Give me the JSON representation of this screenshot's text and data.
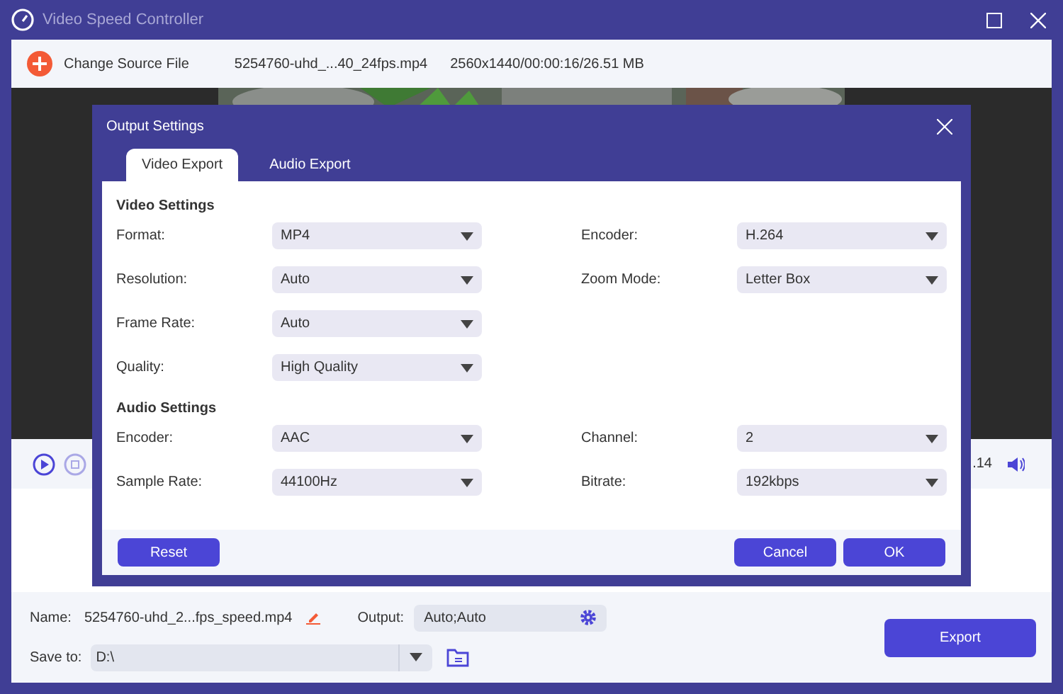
{
  "window": {
    "title": "Video Speed Controller"
  },
  "toolbar": {
    "add_label": "Change Source File",
    "file_name": "5254760-uhd_...40_24fps.mp4",
    "file_info": "2560x1440/00:00:16/26.51 MB"
  },
  "player": {
    "time": ".14"
  },
  "dialog": {
    "title": "Output Settings",
    "tabs": [
      {
        "label": "Video Export",
        "selected": true
      },
      {
        "label": "Audio Export",
        "selected": false
      }
    ],
    "sections": [
      {
        "heading": "Video Settings",
        "rows": [
          [
            {
              "label": "Format:",
              "value": "MP4"
            },
            {
              "label": "Encoder:",
              "value": "H.264"
            }
          ],
          [
            {
              "label": "Resolution:",
              "value": "Auto"
            },
            {
              "label": "Zoom Mode:",
              "value": "Letter Box"
            }
          ],
          [
            {
              "label": "Frame Rate:",
              "value": "Auto"
            }
          ],
          [
            {
              "label": "Quality:",
              "value": "High Quality"
            }
          ]
        ]
      },
      {
        "heading": "Audio Settings",
        "rows": [
          [
            {
              "label": "Encoder:",
              "value": "AAC"
            },
            {
              "label": "Channel:",
              "value": "2"
            }
          ],
          [
            {
              "label": "Sample Rate:",
              "value": "44100Hz"
            },
            {
              "label": "Bitrate:",
              "value": "192kbps"
            }
          ]
        ]
      }
    ],
    "buttons": {
      "reset": "Reset",
      "cancel": "Cancel",
      "ok": "OK"
    }
  },
  "bottom": {
    "name_label": "Name:",
    "name_value": "5254760-uhd_2...fps_speed.mp4",
    "output_label": "Output:",
    "output_value": "Auto;Auto",
    "save_label": "Save to:",
    "save_value": "D:\\",
    "export": "Export"
  }
}
